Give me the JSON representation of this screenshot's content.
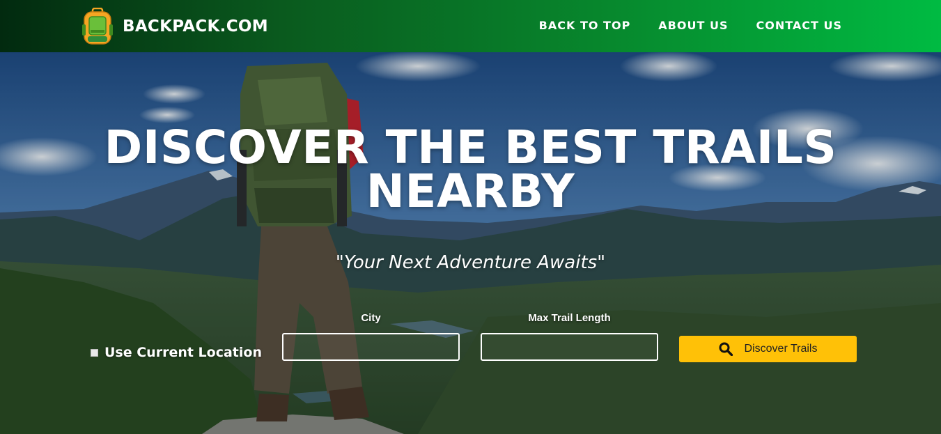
{
  "header": {
    "brand_name": "BACKPACK.COM",
    "logo_icon": "backpack-icon",
    "nav": [
      {
        "label": "BACK TO TOP"
      },
      {
        "label": "ABOUT US"
      },
      {
        "label": "CONTACT US"
      }
    ],
    "gradient_colors": [
      "#022a0f",
      "#00bb42"
    ]
  },
  "hero": {
    "title_line1": "DISCOVER THE BEST TRAILS",
    "title_line2": "NEARBY",
    "tagline": "\"Your Next Adventure Awaits\"",
    "background": "photo of hiker with large green backpack overlooking mountain valley"
  },
  "search": {
    "use_location_label": "Use Current Location",
    "use_location_checked": false,
    "city_label": "City",
    "city_value": "",
    "max_length_label": "Max Trail Length",
    "max_length_value": "",
    "submit_label": "Discover Trails",
    "submit_icon": "search-icon",
    "submit_color": "#ffc107"
  }
}
